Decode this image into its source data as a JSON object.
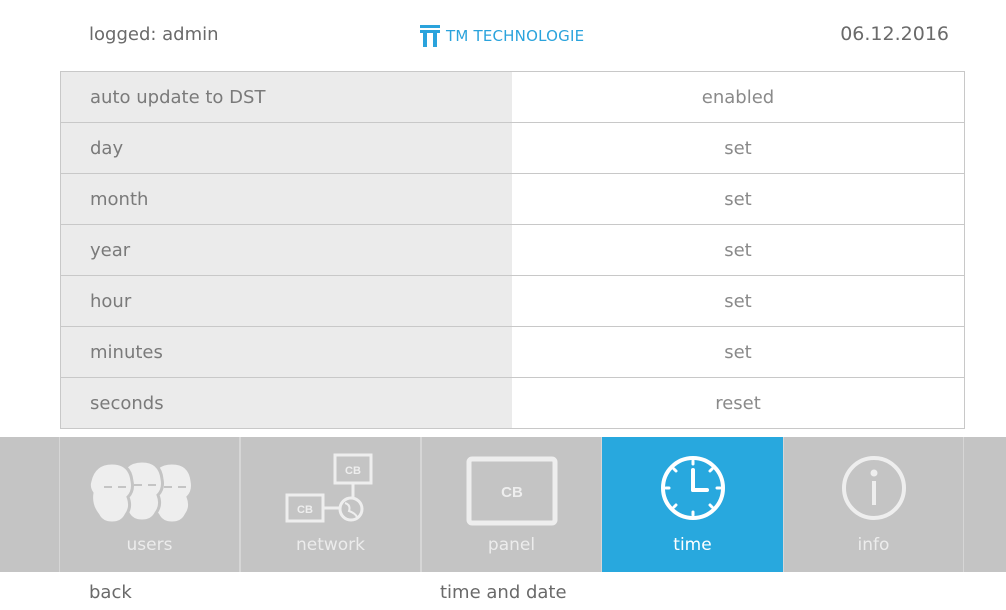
{
  "header": {
    "user_label": "logged: admin",
    "brand": "TM TECHNOLOGIE",
    "date": "06.12.2016",
    "brand_color": "#2aa3dc"
  },
  "settings": [
    {
      "label": "auto update to DST",
      "value": "enabled"
    },
    {
      "label": "day",
      "value": "set"
    },
    {
      "label": "month",
      "value": "set"
    },
    {
      "label": "year",
      "value": "set"
    },
    {
      "label": "hour",
      "value": "set"
    },
    {
      "label": "minutes",
      "value": "set"
    },
    {
      "label": "seconds",
      "value": "reset"
    }
  ],
  "dock": {
    "items": [
      {
        "label": "users",
        "icon": "users-icon"
      },
      {
        "label": "network",
        "icon": "network-icon",
        "badge": "CB"
      },
      {
        "label": "panel",
        "icon": "panel-icon",
        "badge": "CB"
      },
      {
        "label": "time",
        "icon": "clock-icon",
        "active": true
      },
      {
        "label": "info",
        "icon": "info-icon"
      }
    ],
    "active_color": "#28a8de",
    "background_color": "#c4c4c4"
  },
  "footer": {
    "back_label": "back",
    "page_title": "time and date"
  }
}
